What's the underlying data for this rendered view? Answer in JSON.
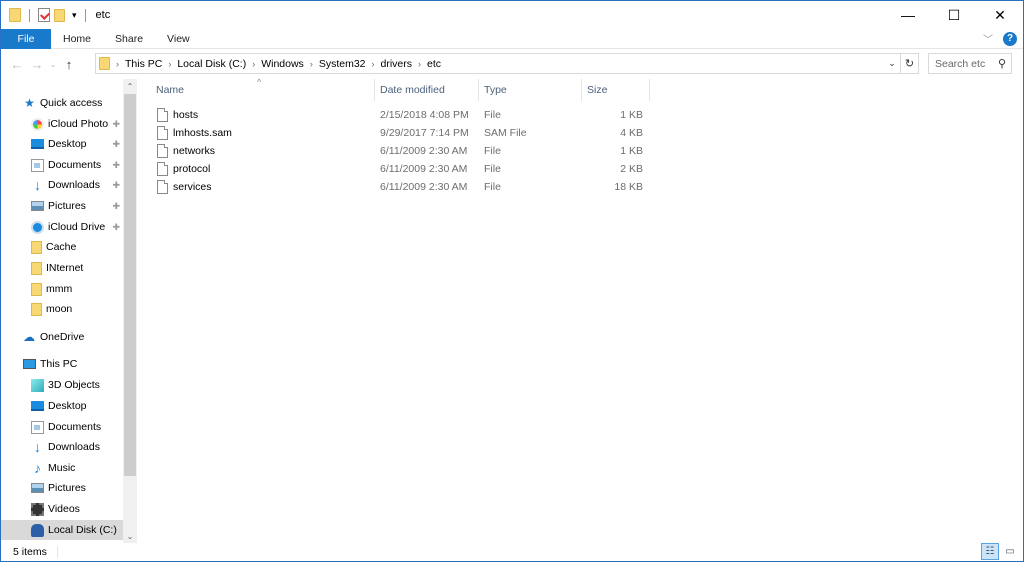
{
  "window": {
    "title": "etc",
    "controls": {
      "minimize": "—",
      "maximize": "☐",
      "close": "✕"
    }
  },
  "ribbon": {
    "file_tab": "File",
    "tabs": [
      "Home",
      "Share",
      "View"
    ],
    "expand_glyph": "﹀",
    "help_glyph": "?"
  },
  "navigation": {
    "back_glyph": "←",
    "forward_glyph": "→",
    "recent_glyph": "⌄",
    "up_glyph": "↑",
    "breadcrumb": [
      "This PC",
      "Local Disk (C:)",
      "Windows",
      "System32",
      "drivers",
      "etc"
    ],
    "separator_glyph": "›",
    "dropdown_glyph": "⌄",
    "refresh_glyph": "↻"
  },
  "search": {
    "placeholder": "Search etc",
    "icon_glyph": "⚲"
  },
  "sidebar": {
    "quick_access": {
      "label": "Quick access",
      "items": [
        {
          "label": "iCloud Photo",
          "icon": "icloud-photos-icon",
          "pinned": true
        },
        {
          "label": "Desktop",
          "icon": "desktop-icon",
          "pinned": true
        },
        {
          "label": "Documents",
          "icon": "documents-icon",
          "pinned": true
        },
        {
          "label": "Downloads",
          "icon": "downloads-icon",
          "pinned": true
        },
        {
          "label": "Pictures",
          "icon": "pictures-icon",
          "pinned": true
        },
        {
          "label": "iCloud Drive",
          "icon": "icloud-drive-icon",
          "pinned": true
        },
        {
          "label": "Cache",
          "icon": "folder-icon",
          "pinned": false
        },
        {
          "label": "INternet",
          "icon": "folder-icon",
          "pinned": false
        },
        {
          "label": "mmm",
          "icon": "folder-icon",
          "pinned": false
        },
        {
          "label": "moon",
          "icon": "folder-icon",
          "pinned": false
        }
      ]
    },
    "onedrive": {
      "label": "OneDrive"
    },
    "this_pc": {
      "label": "This PC",
      "items": [
        {
          "label": "3D Objects",
          "icon": "3d-objects-icon"
        },
        {
          "label": "Desktop",
          "icon": "desktop-icon"
        },
        {
          "label": "Documents",
          "icon": "documents-icon"
        },
        {
          "label": "Downloads",
          "icon": "downloads-icon"
        },
        {
          "label": "Music",
          "icon": "music-icon"
        },
        {
          "label": "Pictures",
          "icon": "pictures-icon"
        },
        {
          "label": "Videos",
          "icon": "videos-icon"
        },
        {
          "label": "Local Disk (C:)",
          "icon": "local-disk-icon",
          "selected": true
        }
      ]
    },
    "pin_glyph": "📌",
    "scroll_up_glyph": "⌃",
    "scroll_down_glyph": "⌄"
  },
  "file_list": {
    "columns": {
      "name": "Name",
      "date": "Date modified",
      "type": "Type",
      "size": "Size"
    },
    "sort_glyph": "^",
    "rows": [
      {
        "name": "hosts",
        "date": "2/15/2018 4:08 PM",
        "type": "File",
        "size": "1 KB"
      },
      {
        "name": "lmhosts.sam",
        "date": "9/29/2017 7:14 PM",
        "type": "SAM File",
        "size": "4 KB"
      },
      {
        "name": "networks",
        "date": "6/11/2009 2:30 AM",
        "type": "File",
        "size": "1 KB"
      },
      {
        "name": "protocol",
        "date": "6/11/2009 2:30 AM",
        "type": "File",
        "size": "2 KB"
      },
      {
        "name": "services",
        "date": "6/11/2009 2:30 AM",
        "type": "File",
        "size": "18 KB"
      }
    ]
  },
  "status": {
    "item_count": "5 items",
    "details_view_glyph": "☷",
    "large_icons_glyph": "▭"
  },
  "colors": {
    "accent": "#1979ca",
    "window_border": "#2b6fc5",
    "selected_nav": "#d9d9d9",
    "folder": "#f8d775"
  }
}
